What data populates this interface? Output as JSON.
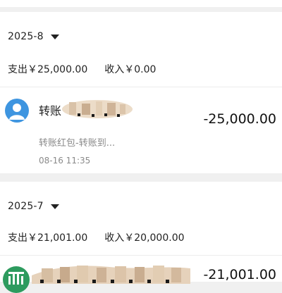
{
  "sections": [
    {
      "month": "2025-8",
      "expense": "支出￥25,000.00",
      "income": "收入￥0.00",
      "transactions": [
        {
          "title": "转账",
          "subtitle": "转账红包-转账到...",
          "time": "08-16 11:35",
          "amount": "-25,000.00",
          "icon": "person-avatar-icon"
        }
      ]
    },
    {
      "month": "2025-7",
      "expense": "支出￥21,001.00",
      "income": "收入￥20,000.00",
      "transactions": [
        {
          "title": "",
          "amount": "-21,001.00",
          "icon": "merchant-logo-icon"
        }
      ]
    }
  ],
  "colors": {
    "background": "#f0f0f0",
    "card": "#ffffff",
    "avatar_blue": "#3e95e0",
    "logo_green": "#2d9b5e",
    "secondary_text": "#8a8a8a"
  }
}
